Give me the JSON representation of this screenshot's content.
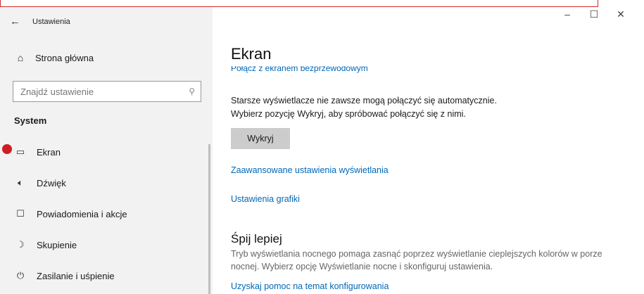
{
  "window": {
    "back_icon": "back-arrow-icon",
    "title": "Ustawienia",
    "minimize": "–",
    "maximize": "☐",
    "close": "✕"
  },
  "sidebar": {
    "home": {
      "icon": "home-icon",
      "label": "Strona główna"
    },
    "search": {
      "placeholder": "Znajdź ustawienie",
      "icon": "search-icon"
    },
    "section": "System",
    "items": [
      {
        "icon": "monitor-icon",
        "label": "Ekran",
        "selected": true
      },
      {
        "icon": "speaker-icon",
        "label": "Dźwięk"
      },
      {
        "icon": "notifications-icon",
        "label": "Powiadomienia i akcje"
      },
      {
        "icon": "focus-assist-icon",
        "label": "Skupienie"
      },
      {
        "icon": "power-icon",
        "label": "Zasilanie i uśpienie"
      }
    ]
  },
  "main": {
    "title": "Ekran",
    "cut_link": "Połącz z ekranem bezprzewodowym",
    "line1": "Starsze wyświetlacze nie zawsze mogą połączyć się automatycznie.",
    "line2": "Wybierz pozycję Wykryj, aby spróbować połączyć się z nimi.",
    "detect_button": "Wykryj",
    "advanced_link": "Zaawansowane ustawienia wyświetlania",
    "graphics_link": "Ustawienia grafiki",
    "sleep_heading": "Śpij lepiej",
    "sleep_text": "Tryb wyświetlania nocnego pomaga zasnąć poprzez wyświetlanie cieplejszych kolorów w porze nocnej. Wybierz opcję Wyświetlanie nocne i skonfiguruj ustawienia.",
    "help_link": "Uzyskaj pomoc na temat konfigurowania"
  },
  "colors": {
    "accent": "#0067b8",
    "sidebar_bg": "#f2f2f2",
    "marker": "#d01c24"
  }
}
